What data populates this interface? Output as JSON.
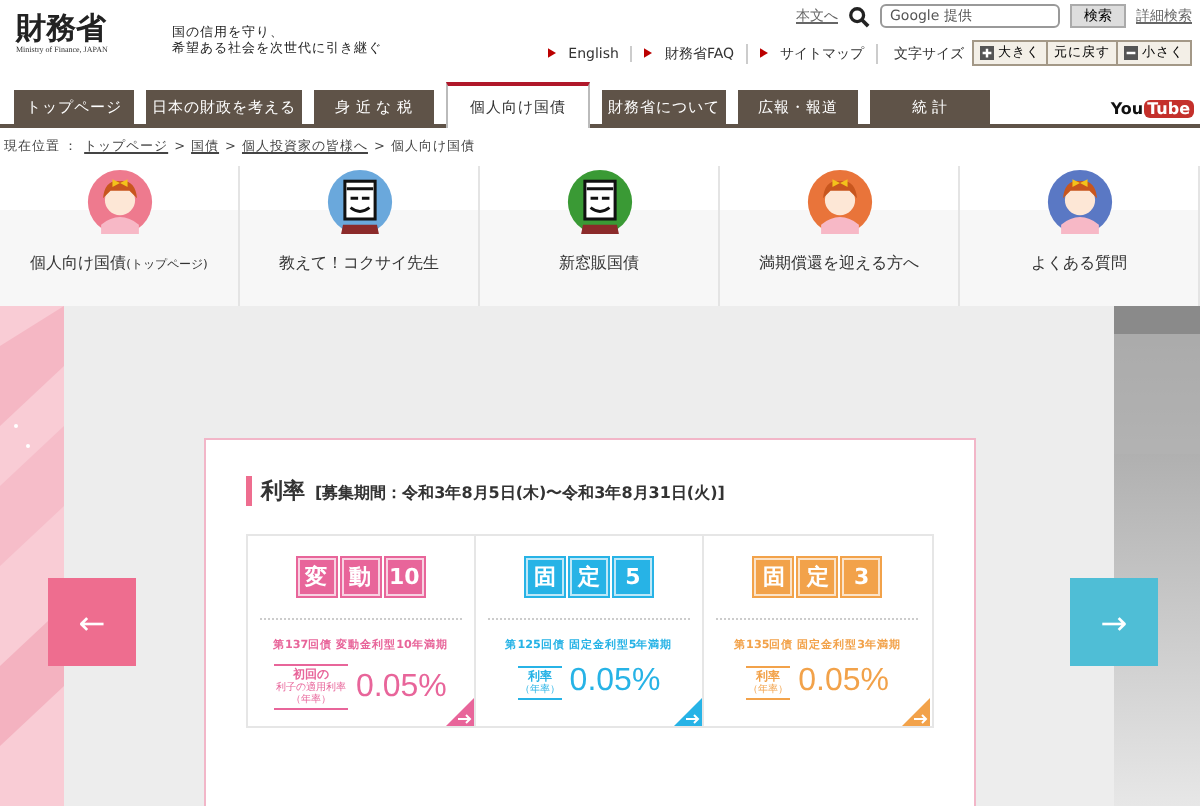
{
  "header": {
    "logo": "財務省",
    "logo_sub": "Ministry of Finance, JAPAN",
    "tagline": [
      "国の信用を守り、",
      "希望ある社会を次世代に引き継ぐ"
    ],
    "skip_link": "本文へ",
    "search": {
      "placeholder": "Google 提供",
      "button": "検索"
    },
    "advanced_search": "詳細検索",
    "links": [
      "English",
      "財務省FAQ",
      "サイトマップ"
    ],
    "font_size": {
      "label": "文字サイズ",
      "buttons": [
        "大きく",
        "元に戻す",
        "小さく"
      ]
    }
  },
  "tabs": [
    {
      "label": "トップページ",
      "selected": false
    },
    {
      "label": "日本の財政を考える",
      "selected": false
    },
    {
      "label": "身 近 な 税",
      "selected": false
    },
    {
      "label": "個人向け国債",
      "selected": true
    },
    {
      "label": "財務省について",
      "selected": false
    },
    {
      "label": "広報・報道",
      "selected": false
    },
    {
      "label": "統 計",
      "selected": false
    }
  ],
  "youtube": {
    "left": "You",
    "right": "Tube"
  },
  "breadcrumb": {
    "label": "現在位置 ：",
    "separator": ">",
    "items": [
      {
        "text": "トップページ",
        "link": true
      },
      {
        "text": "国債",
        "link": true
      },
      {
        "text": "個人投資家の皆様へ",
        "link": true
      },
      {
        "text": "個人向け国債",
        "link": false
      }
    ]
  },
  "quick_nav": [
    {
      "label": "個人向け国債",
      "suffix": "(トップページ)",
      "color": "#ee7a8e",
      "kind": "girl"
    },
    {
      "label": "教えて！コクサイ先生",
      "color": "#6aa8dc",
      "kind": "teacher"
    },
    {
      "label": "新窓販国債",
      "color": "#3a9a35",
      "kind": "teacher"
    },
    {
      "label": "満期償還を迎える方へ",
      "color": "#e9743a",
      "kind": "girl"
    },
    {
      "label": "よくある質問",
      "color": "#5a78c4",
      "kind": "girl"
    }
  ],
  "rates": {
    "title": "利率",
    "period": "[募集期間：令和3年8月5日(木)〜令和3年8月31日(火)]",
    "cards": [
      {
        "tiles": [
          "変",
          "動",
          "10"
        ],
        "color": "#e8659a",
        "series": "第137回債 変動金利型10年満期",
        "rate_label": [
          "初回の",
          "利子の適用利率",
          "（年率）"
        ],
        "rate": "0.05%"
      },
      {
        "tiles": [
          "固",
          "定",
          "5"
        ],
        "color": "#27b3e6",
        "series": "第125回債 固定金利型5年満期",
        "rate_label": [
          "利率",
          "（年率）"
        ],
        "rate": "0.05%"
      },
      {
        "tiles": [
          "固",
          "定",
          "3"
        ],
        "color": "#f2a24a",
        "series": "第135回債 固定金利型3年満期",
        "rate_label": [
          "利率",
          "（年率）"
        ],
        "rate": "0.05%"
      }
    ]
  },
  "carousel": {
    "prev": "←",
    "next": "→"
  }
}
